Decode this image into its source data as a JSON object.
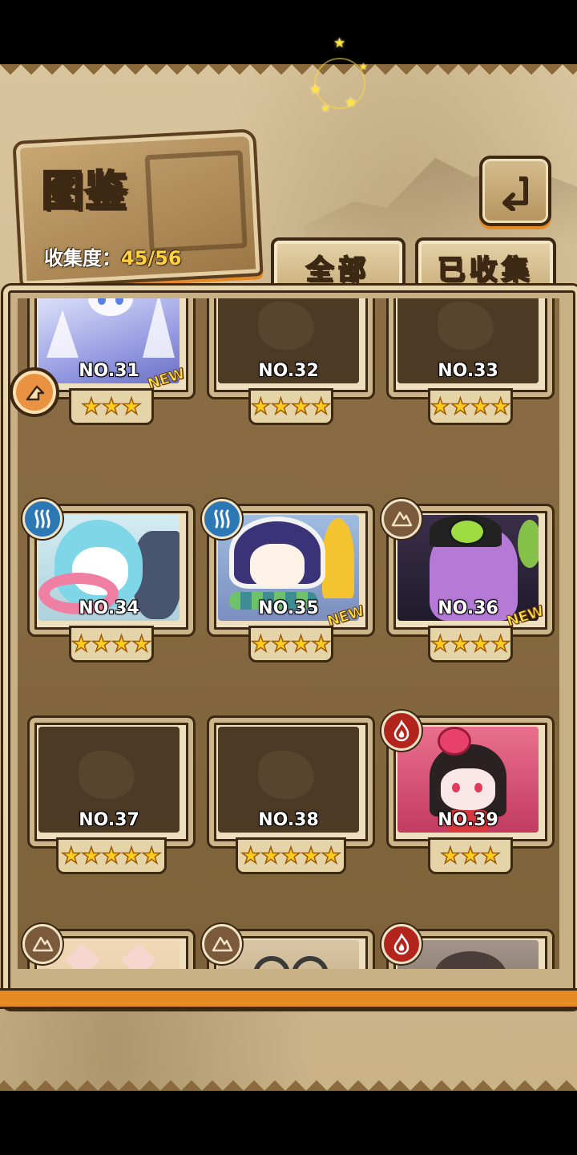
{
  "header": {
    "title": "图鉴",
    "collect_label": "收集度：",
    "collect_value": "45/56"
  },
  "tabs": [
    {
      "label": "全部"
    },
    {
      "label": "已收集"
    }
  ],
  "icons": {
    "back": "back-arrow-icon",
    "side_badge": "arrow-badge-icon",
    "water": "water-waves-icon",
    "earth": "earth-mountain-icon",
    "fire": "fire-flame-icon"
  },
  "colors": {
    "accent_orange": "#e68a24",
    "outline_brown": "#3d2814",
    "star_gold": "#ffcc1e",
    "new_yellow": "#ffe14a"
  },
  "new_badge": "NEW",
  "cards": [
    {
      "number": "NO.31",
      "stars": 3,
      "element": "",
      "collected": true,
      "is_new": true
    },
    {
      "number": "NO.32",
      "stars": 4,
      "element": "",
      "collected": false,
      "is_new": false
    },
    {
      "number": "NO.33",
      "stars": 4,
      "element": "",
      "collected": false,
      "is_new": false
    },
    {
      "number": "NO.34",
      "stars": 4,
      "element": "water",
      "collected": true,
      "is_new": false
    },
    {
      "number": "NO.35",
      "stars": 4,
      "element": "water",
      "collected": true,
      "is_new": true
    },
    {
      "number": "NO.36",
      "stars": 4,
      "element": "earth",
      "collected": true,
      "is_new": true
    },
    {
      "number": "NO.37",
      "stars": 5,
      "element": "",
      "collected": false,
      "is_new": false
    },
    {
      "number": "NO.38",
      "stars": 5,
      "element": "",
      "collected": false,
      "is_new": false
    },
    {
      "number": "NO.39",
      "stars": 3,
      "element": "fire",
      "collected": true,
      "is_new": false
    },
    {
      "number": "",
      "stars": 0,
      "element": "earth",
      "collected": true,
      "is_new": false
    },
    {
      "number": "",
      "stars": 0,
      "element": "earth",
      "collected": true,
      "is_new": false
    },
    {
      "number": "",
      "stars": 0,
      "element": "fire",
      "collected": true,
      "is_new": false
    }
  ]
}
